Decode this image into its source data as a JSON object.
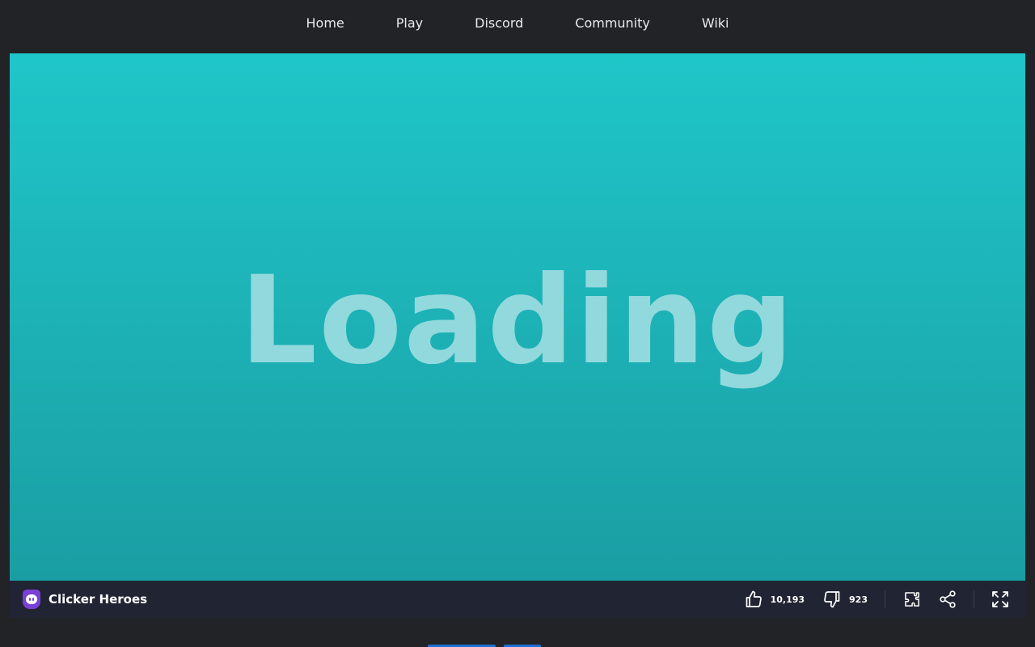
{
  "nav": {
    "items": [
      {
        "label": "Home"
      },
      {
        "label": "Play"
      },
      {
        "label": "Discord"
      },
      {
        "label": "Community"
      },
      {
        "label": "Wiki"
      }
    ]
  },
  "game": {
    "loading_text": "Loading"
  },
  "bottom_bar": {
    "title": "Clicker Heroes",
    "likes": "10,193",
    "dislikes": "923"
  },
  "icons": {
    "logo": "purple-shield-logo-icon",
    "like": "thumbs-up-icon",
    "dislike": "thumbs-down-icon",
    "embed": "puzzle-icon",
    "share": "share-icon",
    "fullscreen": "fullscreen-icon"
  },
  "colors": {
    "page_bg": "#222326",
    "bar_bg": "#212433",
    "game_bg_top": "#1fc6c9",
    "game_bg_bottom": "#1a9ea3",
    "loading_text": "#91d9dc",
    "logo": "#7a3fd6",
    "accent_blue": "#1d6fd6"
  }
}
